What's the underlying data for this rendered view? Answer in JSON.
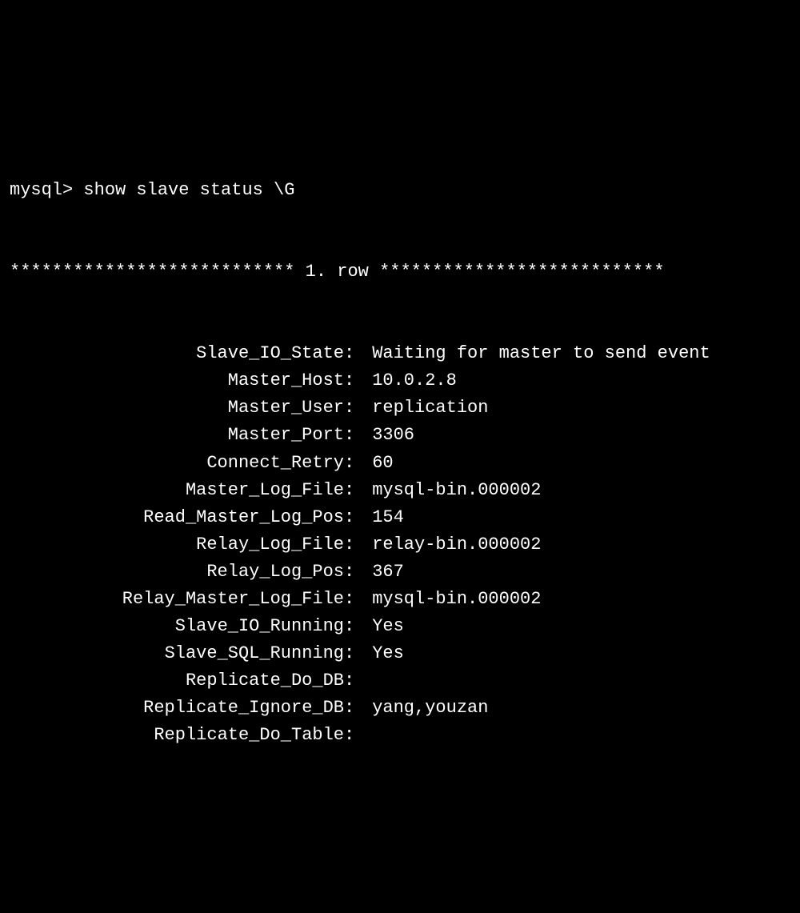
{
  "prompt": "mysql> ",
  "command": "show slave status \\G",
  "row_header": "*************************** 1. row ***************************",
  "fields": [
    {
      "label": "Slave_IO_State",
      "value": "Waiting for master to send event"
    },
    {
      "label": "Master_Host",
      "value": "10.0.2.8"
    },
    {
      "label": "Master_User",
      "value": "replication"
    },
    {
      "label": "Master_Port",
      "value": "3306"
    },
    {
      "label": "Connect_Retry",
      "value": "60"
    },
    {
      "label": "Master_Log_File",
      "value": "mysql-bin.000002"
    },
    {
      "label": "Read_Master_Log_Pos",
      "value": "154"
    },
    {
      "label": "Relay_Log_File",
      "value": "relay-bin.000002"
    },
    {
      "label": "Relay_Log_Pos",
      "value": "367"
    },
    {
      "label": "Relay_Master_Log_File",
      "value": "mysql-bin.000002"
    },
    {
      "label": "Slave_IO_Running",
      "value": "Yes"
    },
    {
      "label": "Slave_SQL_Running",
      "value": "Yes"
    },
    {
      "label": "Replicate_Do_DB",
      "value": ""
    },
    {
      "label": "Replicate_Ignore_DB",
      "value": "yang,youzan"
    },
    {
      "label": "Replicate_Do_Table",
      "value": ""
    }
  ]
}
